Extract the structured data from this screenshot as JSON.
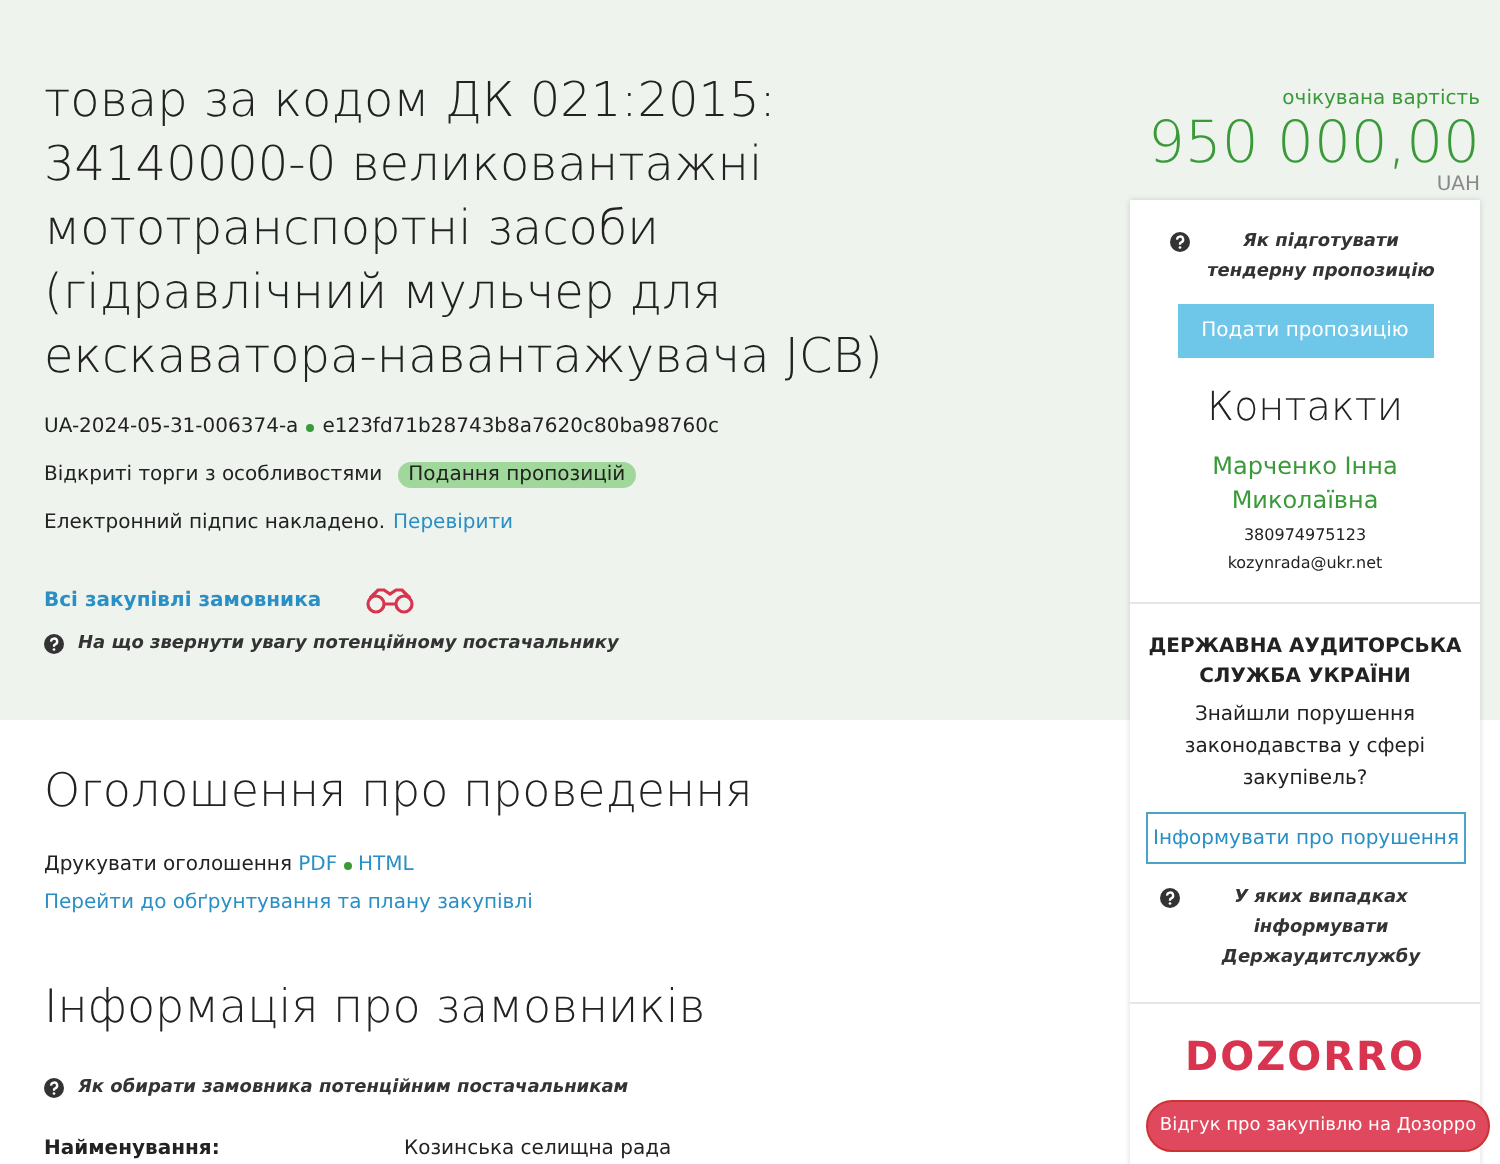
{
  "tender": {
    "title": "товар за кодом ДК 021:2015: 34140000-0 великовантажні мототранспортні засоби (гідравлічний мульчер для екскаватора-навантажувача JCB)",
    "id": "UA-2024-05-31-006374-a",
    "hash": "e123fd71b28743b8a7620c80ba98760c",
    "procedure": "Відкриті торги з особливостями",
    "status": "Подання пропозицій",
    "signature_text": "Електронний підпис накладено.",
    "signature_link": "Перевірити",
    "customer_link": "Всі закупівлі замовника",
    "hint": "На що звернути увагу потенційному постачальнику"
  },
  "value": {
    "label": "очікувана вартість",
    "amount": "950 000,00",
    "currency": "UAH"
  },
  "sidebar": {
    "hint": "Як підготувати тендерну пропозицію",
    "submit_button": "Подати пропозицію",
    "contacts_title": "Контакти",
    "contact_name": "Марченко Інна Миколаївна",
    "phone": "380974975123",
    "email": "kozynrada@ukr.net",
    "audit": {
      "title": "ДЕРЖАВНА АУДИТОРСЬКА СЛУЖБА УКРАЇНИ",
      "question": "Знайшли порушення законодавства у сфері закупівель?",
      "button": "Інформувати про порушення",
      "hint": "У яких випадках інформувати Держаудитслужбу"
    },
    "dozorro": {
      "logo": "DOZORRO",
      "button": "Відгук про закупівлю на Дозорро"
    }
  },
  "announcement": {
    "title": "Оголошення про проведення",
    "print_label": "Друкувати оголошення",
    "print_links": [
      "PDF",
      "HTML"
    ],
    "plan_link": "Перейти до обґрунтування та плану закупівлі"
  },
  "customers": {
    "title": "Інформація про замовників",
    "hint": "Як обирати замовника потенційним постачальникам",
    "fields": [
      {
        "label": "Найменування:",
        "value": "Козинська селищна рада"
      }
    ]
  }
}
